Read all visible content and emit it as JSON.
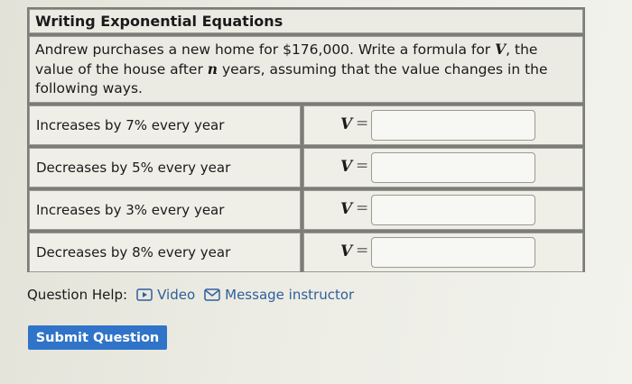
{
  "problem": {
    "title": "Writing Exponential Equations",
    "prompt_part1": "Andrew purchases a new home for $176,000. Write a formula for ",
    "prompt_var1": "V",
    "prompt_part2": ", the value of the house after ",
    "prompt_var2": "n",
    "prompt_part3": " years, assuming that the value changes in the following ways.",
    "rows": [
      {
        "condition": "Increases by 7% every year",
        "var": "V",
        "eq": "=",
        "answer": ""
      },
      {
        "condition": "Decreases by 5% every year",
        "var": "V",
        "eq": "=",
        "answer": ""
      },
      {
        "condition": "Increases by 3% every year",
        "var": "V",
        "eq": "=",
        "answer": ""
      },
      {
        "condition": "Decreases by 8% every year",
        "var": "V",
        "eq": "=",
        "answer": ""
      }
    ]
  },
  "help": {
    "label": "Question Help:",
    "video_label": "Video",
    "message_label": "Message instructor",
    "video_icon": "video-play-icon",
    "message_icon": "envelope-icon"
  },
  "submit": {
    "label": "Submit Question",
    "color": "#2f74c8"
  }
}
